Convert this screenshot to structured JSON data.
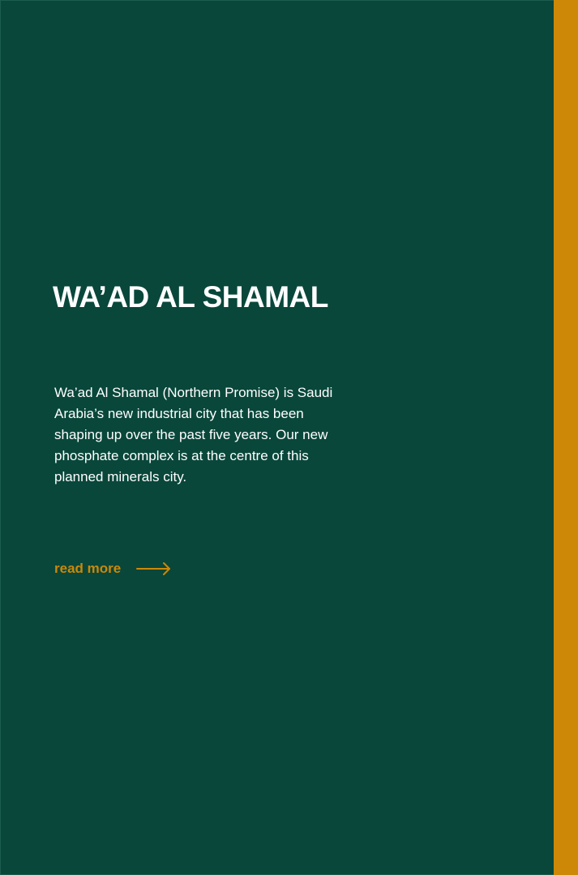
{
  "colors": {
    "background": "#09473b",
    "accent": "#cc8806",
    "text": "#ffffff"
  },
  "header": {
    "title": "WA’AD AL SHAMAL"
  },
  "main": {
    "description": "Wa’ad Al Shamal (Northern Promise) is Saudi Arabia’s new industrial city that has been shaping up over the past five years. Our new phosphate complex is at the centre of this planned minerals city."
  },
  "read_more": {
    "label": "read more",
    "icon": "arrow-right-icon"
  }
}
